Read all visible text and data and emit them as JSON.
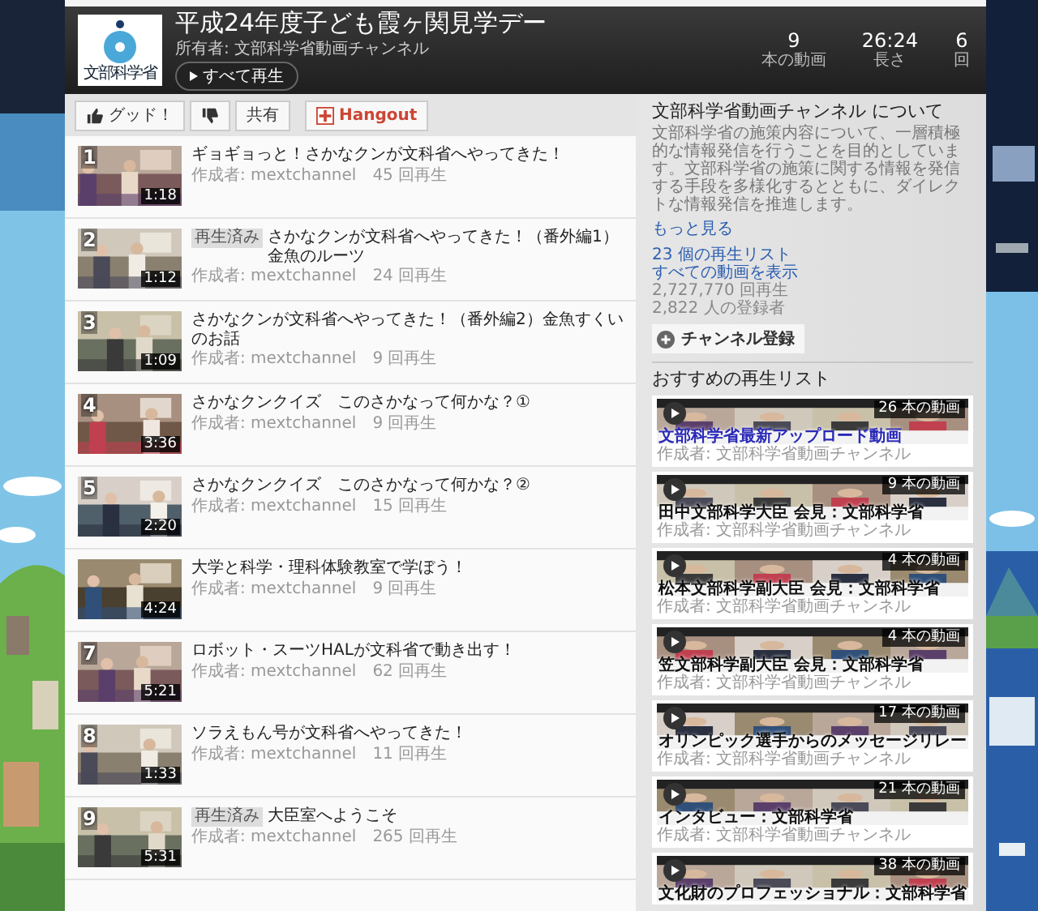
{
  "header": {
    "logo_text": "文部科学省",
    "title": "平成24年度子ども霞ヶ関見学デー",
    "owner": "所有者: 文部科学省動画チャンネル",
    "play_all": "すべて再生",
    "stats": [
      {
        "value": "9",
        "label": "本の動画"
      },
      {
        "value": "26:24",
        "label": "長さ"
      },
      {
        "value": "6",
        "label": "回"
      }
    ]
  },
  "toolbar": [
    {
      "kind": "like",
      "label": "グッド！"
    },
    {
      "kind": "dislike"
    },
    {
      "kind": "share",
      "label": "共有"
    },
    {
      "kind": "hangout",
      "label": "Hangout"
    }
  ],
  "videos": [
    {
      "number": "1",
      "title": "ギョギョっと！さかなクンが文科省へやってきた！",
      "author": "作成者: mextchannel",
      "views": "45 回再生",
      "duration": "1:18"
    },
    {
      "number": "2",
      "badge": "再生済み",
      "title": "さかなクンが文科省へやってきた！（番外編1）金魚のルーツ",
      "author": "作成者: mextchannel",
      "views": "24 回再生",
      "duration": "1:12"
    },
    {
      "number": "3",
      "title": "さかなクンが文科省へやってきた！（番外編2）金魚すくいのお話",
      "author": "作成者: mextchannel",
      "views": "9 回再生",
      "duration": "1:09"
    },
    {
      "number": "4",
      "title": "さかなクンクイズ　このさかなって何かな？①",
      "author": "作成者: mextchannel",
      "views": "9 回再生",
      "duration": "3:36"
    },
    {
      "number": "5",
      "title": "さかなクンクイズ　このさかなって何かな？②",
      "author": "作成者: mextchannel",
      "views": "15 回再生",
      "duration": "2:20"
    },
    {
      "title": "大学と科学・理科体験教室で学ぼう！",
      "author": "作成者: mextchannel",
      "views": "9 回再生",
      "duration": "4:24"
    },
    {
      "number": "7",
      "title": "ロボット・スーツHALが文科省で動き出す！",
      "author": "作成者: mextchannel",
      "views": "62 回再生",
      "duration": "5:21"
    },
    {
      "number": "8",
      "title": "ソラえもん号が文科省へやってきた！",
      "author": "作成者: mextchannel",
      "views": "11 回再生",
      "duration": "1:33"
    },
    {
      "number": "9",
      "badge": "再生済み",
      "title": "大臣室へようこそ",
      "author": "作成者: mextchannel",
      "views": "265 回再生",
      "duration": "5:31"
    }
  ],
  "about": {
    "title": "文部科学省動画チャンネル について",
    "description": "文部科学省の施策内容について、一層積極的な情報発信を行うことを目的としています。文部科学省の施策に関する情報を発信する手段を多様化するとともに、ダイレクトな情報発信を推進します。",
    "more": "もっと見る",
    "links": [
      "23 個の再生リスト",
      "すべての動画を表示"
    ],
    "stats": [
      "2,727,770 回再生",
      "2,822 人の登録者"
    ],
    "subscribe": "チャンネル登録"
  },
  "recommended": {
    "heading": "おすすめの再生リスト",
    "playlists": [
      {
        "title": "文部科学省最新アップロード動画",
        "highlighted": true,
        "author": "作成者: 文部科学省動画チャンネル",
        "count": "26 本の動画"
      },
      {
        "title": "田中文部科学大臣 会見：文部科学省",
        "highlighted": false,
        "author": "作成者: 文部科学省動画チャンネル",
        "count": "9 本の動画"
      },
      {
        "title": "松本文部科学副大臣 会見：文部科学省",
        "highlighted": false,
        "author": "作成者: 文部科学省動画チャンネル",
        "count": "4 本の動画"
      },
      {
        "title": "笠文部科学副大臣 会見：文部科学省",
        "highlighted": false,
        "author": "作成者: 文部科学省動画チャンネル",
        "count": "4 本の動画"
      },
      {
        "title": "オリンピック選手からのメッセージリレー",
        "highlighted": false,
        "author": "作成者: 文部科学省動画チャンネル",
        "count": "17 本の動画"
      },
      {
        "title": "インタビュー：文部科学省",
        "highlighted": false,
        "author": "作成者: 文部科学省動画チャンネル",
        "count": "21 本の動画"
      },
      {
        "title": "文化財のプロフェッショナル：文部科学省",
        "highlighted": false,
        "count": "38 本の動画"
      }
    ]
  }
}
